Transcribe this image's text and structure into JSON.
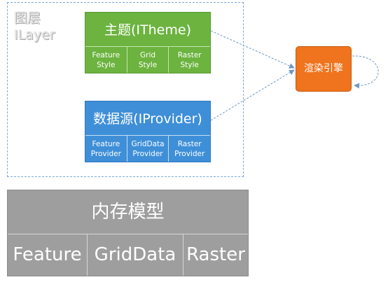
{
  "layer": {
    "title_line1": "图层",
    "title_line2": "ILayer"
  },
  "theme": {
    "title": "主题(ITheme)",
    "cells": [
      {
        "line1": "Feature",
        "line2": "Style"
      },
      {
        "line1": "Grid",
        "line2": "Style"
      },
      {
        "line1": "Raster",
        "line2": "Style"
      }
    ]
  },
  "provider": {
    "title": "数据源(IProvider)",
    "cells": [
      {
        "line1": "Feature",
        "line2": "Provider"
      },
      {
        "line1": "GridData",
        "line2": "Provider"
      },
      {
        "line1": "Raster",
        "line2": "Provider"
      }
    ]
  },
  "engine": {
    "label": "渲染引擎"
  },
  "memory": {
    "title": "内存模型",
    "cells": [
      "Feature",
      "GridData",
      "Raster"
    ]
  },
  "colors": {
    "theme": "#6cb33f",
    "provider": "#3f8fd8",
    "engine": "#f0731d",
    "memory": "#9e9e9e",
    "connector": "#6f97c7"
  }
}
